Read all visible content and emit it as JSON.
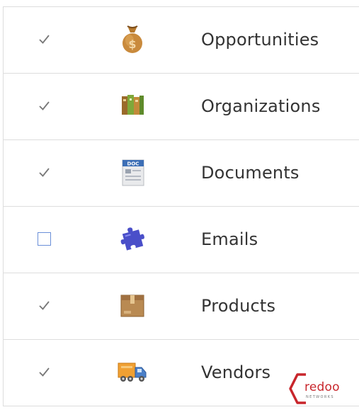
{
  "rows": [
    {
      "label": "Opportunities",
      "checked": true,
      "icon": "money-bag-icon"
    },
    {
      "label": "Organizations",
      "checked": true,
      "icon": "books-icon"
    },
    {
      "label": "Documents",
      "checked": true,
      "icon": "document-icon"
    },
    {
      "label": "Emails",
      "checked": false,
      "icon": "puzzle-icon"
    },
    {
      "label": "Products",
      "checked": true,
      "icon": "box-icon"
    },
    {
      "label": "Vendors",
      "checked": true,
      "icon": "truck-icon"
    }
  ],
  "logo": {
    "text": "redoo",
    "subtext": "NETWORKS",
    "color": "#c8262c"
  },
  "colors": {
    "checkbox_border": "#6a8fd8",
    "checkmark": "#666666",
    "divider": "#dddddd"
  }
}
